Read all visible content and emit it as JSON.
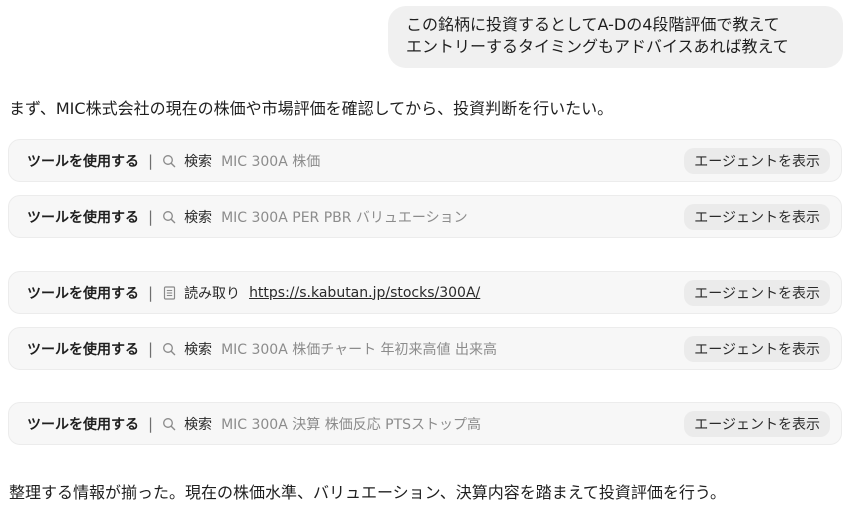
{
  "user_message": {
    "lines": [
      "この銘柄に投資するとしてA-Dの4段階評価で教えて",
      "エントリーするタイミングもアドバイスあれば教えて"
    ]
  },
  "assistant": {
    "intro": "まず、MIC株式会社の現在の株価や市場評価を確認してから、投資判断を行いたい。",
    "summary": "整理する情報が揃った。現在の株価水準、バリュエーション、決算内容を踏まえて投資評価を行う。"
  },
  "tool_calls": [
    {
      "label": "ツールを使用する",
      "separator": "|",
      "icon": "search-icon",
      "action": "検索",
      "query": "MIC 300A 株価",
      "button": "エージェントを表示"
    },
    {
      "label": "ツールを使用する",
      "separator": "|",
      "icon": "search-icon",
      "action": "検索",
      "query": "MIC 300A PER PBR バリュエーション",
      "button": "エージェントを表示"
    },
    {
      "label": "ツールを使用する",
      "separator": "|",
      "icon": "document-icon",
      "action": "読み取り",
      "link": "https://s.kabutan.jp/stocks/300A/",
      "button": "エージェントを表示"
    },
    {
      "label": "ツールを使用する",
      "separator": "|",
      "icon": "search-icon",
      "action": "検索",
      "query": "MIC 300A 株価チャート 年初来高値 出来高",
      "button": "エージェントを表示"
    },
    {
      "label": "ツールを使用する",
      "separator": "|",
      "icon": "search-icon",
      "action": "検索",
      "query": "MIC 300A 決算 株価反応 PTSストップ高",
      "button": "エージェントを表示"
    }
  ]
}
